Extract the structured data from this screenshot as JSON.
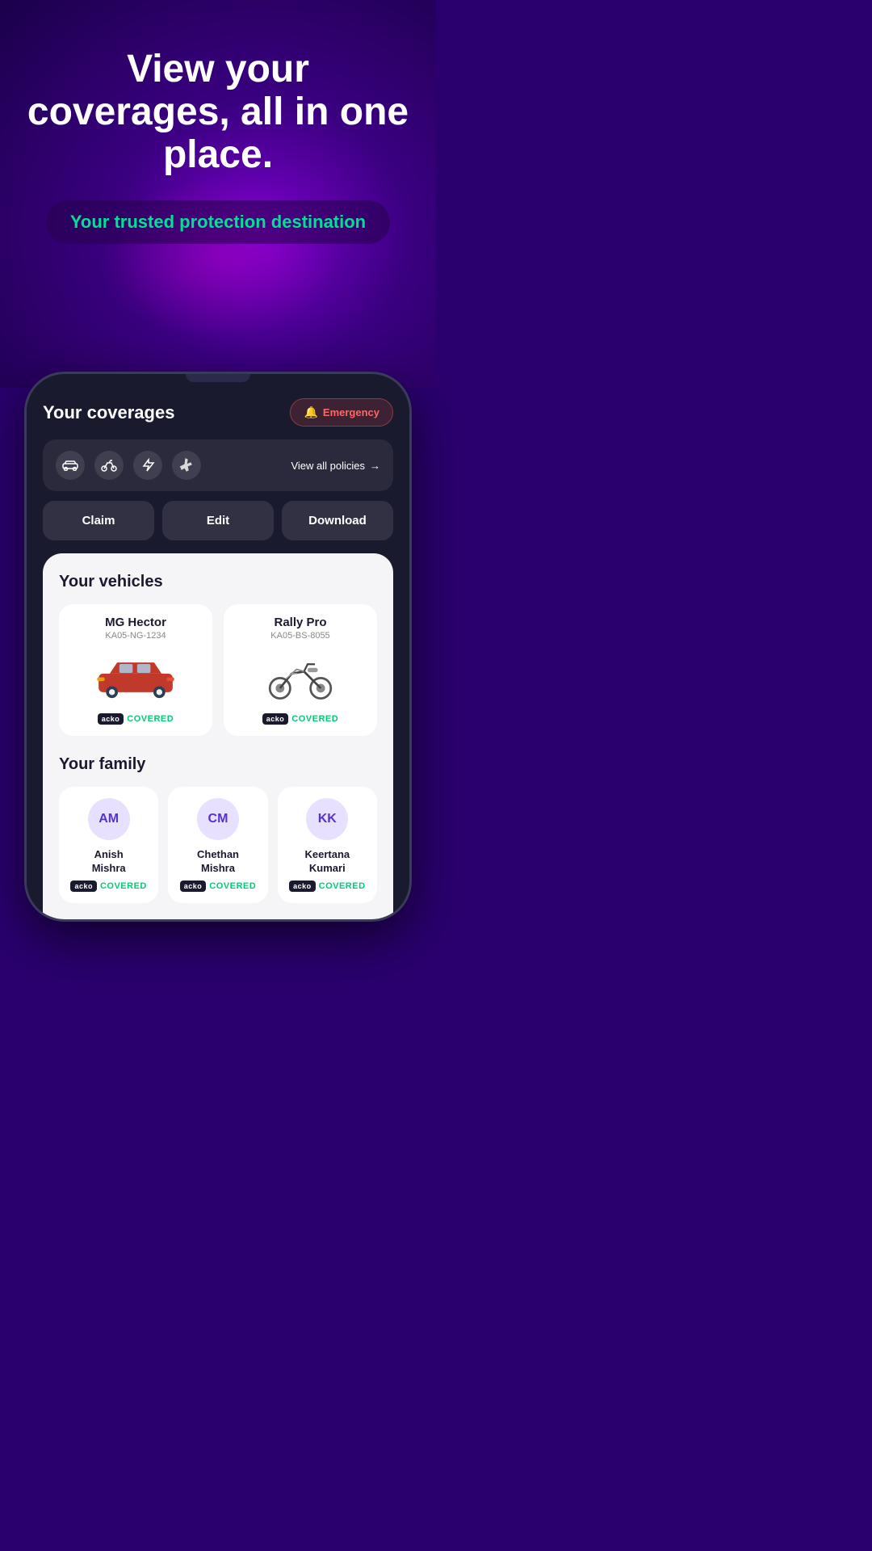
{
  "hero": {
    "title": "View your coverages, all in one place.",
    "subtitle": "Your trusted protection destination"
  },
  "phone": {
    "coverages_title": "Your coverages",
    "emergency_label": "Emergency",
    "policy_icons": [
      "🚗",
      "🏍️",
      "⚡",
      "✈️"
    ],
    "view_all_label": "View all policies",
    "action_buttons": {
      "claim": "Claim",
      "edit": "Edit",
      "download": "Download"
    },
    "vehicles_section": {
      "title": "Your vehicles",
      "vehicles": [
        {
          "name": "MG Hector",
          "plate": "KA05-NG-1234",
          "type": "car",
          "status": "COVERED"
        },
        {
          "name": "Rally Pro",
          "plate": "KA05-BS-8055",
          "type": "bike",
          "status": "COVERED"
        }
      ]
    },
    "family_section": {
      "title": "Your family",
      "members": [
        {
          "initials": "AM",
          "name": "Anish\nMishra",
          "name_line1": "Anish",
          "name_line2": "Mishra",
          "status": "COVERED"
        },
        {
          "initials": "CM",
          "name": "Chethan\nMishra",
          "name_line1": "Chethan",
          "name_line2": "Mishra",
          "status": "COVERED"
        },
        {
          "initials": "KK",
          "name": "Keertana\nKumari",
          "name_line1": "Keertana",
          "name_line2": "Kumari",
          "status": "COVERED"
        }
      ]
    }
  },
  "colors": {
    "accent_green": "#00e096",
    "accent_purple": "#7b00cc",
    "emergency_red": "#ff6666",
    "covered_green": "#00cc77"
  }
}
